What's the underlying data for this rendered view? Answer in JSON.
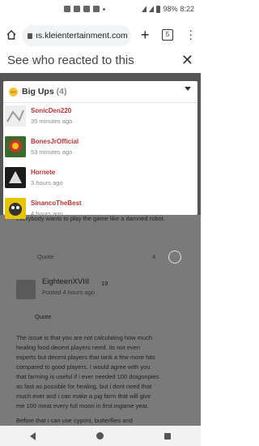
{
  "status": {
    "battery": "98%",
    "time": "8:22"
  },
  "browser": {
    "url": "ıs.kleientertainment.com",
    "tab_count": "5"
  },
  "modal": {
    "title": "See who reacted to this",
    "reaction": "Big Ups",
    "reaction_count": "(4)",
    "users": [
      {
        "name": "SonicDen220",
        "time": "35 minutes ago"
      },
      {
        "name": "BonesJrOfficial",
        "time": "53 minutes ago"
      },
      {
        "name": "Hornete",
        "time": "3 hours ago"
      },
      {
        "name": "SinancoTheBest",
        "time": "4 hours ago"
      }
    ]
  },
  "page": {
    "snippet_top": "everybody wants to play the game like a damned robot.",
    "quote_link": "Quote",
    "reaction_badge": "4",
    "author": "EighteenXVIII",
    "author_score": "19",
    "posted": "Posted 4 hours ago",
    "quote_label": "Quote",
    "body": [
      "The issue is that you are not calculating how much",
      "healing food decent players need. its not even",
      "experts but decent players that tank a few more hits",
      "compared to good players. I would agree with you",
      "that farming is useful if i ever needed 100 dragonpies",
      "as fast as possible for healing, but i dont need that",
      "much ever and i can make a pig farm that will give",
      "me 100 meat every full moon in first ingame year.",
      "Before that i can use cyponi, butterflies and"
    ]
  }
}
